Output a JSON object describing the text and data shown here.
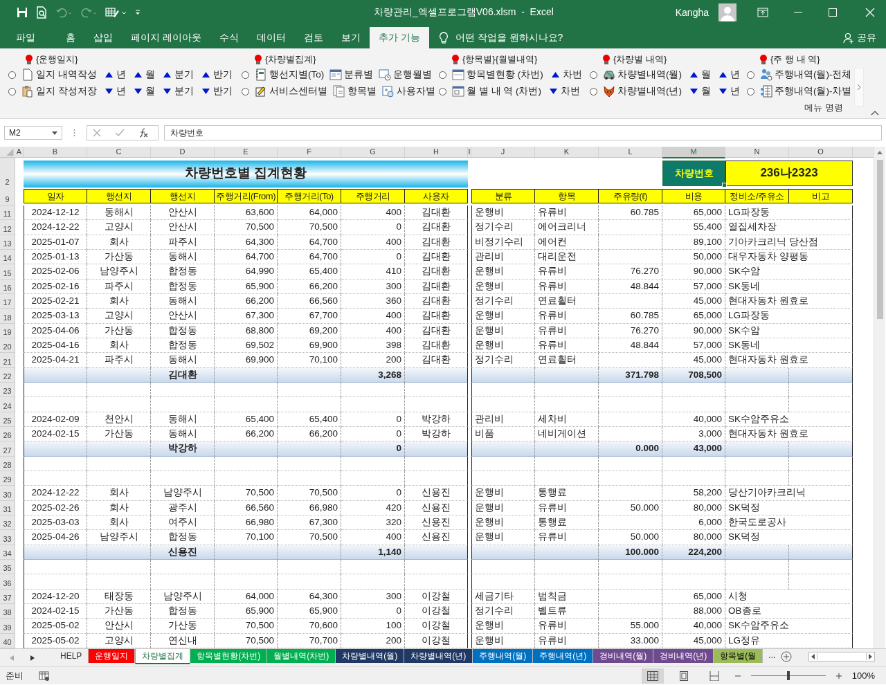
{
  "window": {
    "title": "차량관리_엑셀프로그램V06.xlsm  -  Excel",
    "user": "Kangha"
  },
  "ribbon_tabs": [
    {
      "label": "파일",
      "selected": false
    },
    {
      "label": "홈",
      "selected": false
    },
    {
      "label": "삽입",
      "selected": false
    },
    {
      "label": "페이지 레이아웃",
      "selected": false
    },
    {
      "label": "수식",
      "selected": false
    },
    {
      "label": "데이터",
      "selected": false
    },
    {
      "label": "검토",
      "selected": false
    },
    {
      "label": "보기",
      "selected": false
    },
    {
      "label": "추가 기능",
      "selected": true
    }
  ],
  "tell_me": "어떤 작업을 원하시나요?",
  "share": "공유",
  "ribbon": {
    "groups": [
      {
        "title": "{운행일지}",
        "lines": [
          [
            {
              "kind": "radio",
              "selected": false
            },
            {
              "kind": "command",
              "label": "일지 내역작성"
            },
            {
              "kind": "sort-up",
              "label": "년"
            },
            {
              "kind": "sort-up",
              "label": "월"
            },
            {
              "kind": "sort-up",
              "label": "분기"
            },
            {
              "kind": "sort-up",
              "label": "반기"
            }
          ],
          [
            {
              "kind": "radio",
              "selected": false
            },
            {
              "kind": "command",
              "label": "일지 작성저장"
            },
            {
              "kind": "sort-down",
              "label": "년"
            },
            {
              "kind": "sort-down",
              "label": "월"
            },
            {
              "kind": "sort-down",
              "label": "분기"
            },
            {
              "kind": "sort-down",
              "label": "반기"
            }
          ]
        ]
      },
      {
        "title": "{차량별집계}",
        "lines": [
          [
            {
              "kind": "radio",
              "selected": false
            },
            {
              "kind": "command",
              "label": "행선지별(To)"
            },
            {
              "kind": "command",
              "label": "분류별"
            },
            {
              "kind": "command",
              "label": "운행월별"
            }
          ],
          [
            {
              "kind": "radio",
              "selected": false
            },
            {
              "kind": "command",
              "label": "서비스센터별"
            },
            {
              "kind": "command",
              "label": "항목별"
            },
            {
              "kind": "command",
              "label": "사용자별"
            }
          ]
        ]
      },
      {
        "title": "{항목별}{월별내역}",
        "lines": [
          [
            {
              "kind": "radio",
              "selected": false
            },
            {
              "kind": "command",
              "label": "항목별현황 (차번)"
            },
            {
              "kind": "sort-up",
              "label": "차번"
            }
          ],
          [
            {
              "kind": "radio",
              "selected": false
            },
            {
              "kind": "command",
              "label": "월 별 내 역 (차번)"
            },
            {
              "kind": "sort-down",
              "label": "차번"
            }
          ]
        ]
      },
      {
        "title": "{차량별 내역}",
        "lines": [
          [
            {
              "kind": "radio",
              "selected": false
            },
            {
              "kind": "command",
              "label": "차량별내역(월)"
            },
            {
              "kind": "sort-up",
              "label": "월"
            },
            {
              "kind": "sort-up",
              "label": "년"
            }
          ],
          [
            {
              "kind": "radio",
              "selected": false
            },
            {
              "kind": "command",
              "label": "차량별내역(년)"
            },
            {
              "kind": "sort-down",
              "label": "월"
            },
            {
              "kind": "sort-down",
              "label": "년"
            }
          ]
        ]
      },
      {
        "title": "{주 행 내 역}",
        "lines": [
          [
            {
              "kind": "radio",
              "selected": false
            },
            {
              "kind": "command",
              "label": "주행내역(월)-전체"
            }
          ],
          [
            {
              "kind": "radio",
              "selected": false
            },
            {
              "kind": "command",
              "label": "주행내역(월)-차별"
            }
          ]
        ]
      }
    ],
    "group_label": "메뉴 명령"
  },
  "formula_bar": {
    "name_box": "M2",
    "content": "차량번호"
  },
  "sheet": {
    "columns": [
      {
        "label": "A",
        "selected": false
      },
      {
        "label": "B",
        "selected": false
      },
      {
        "label": "C",
        "selected": false
      },
      {
        "label": "D",
        "selected": false
      },
      {
        "label": "E",
        "selected": false
      },
      {
        "label": "F",
        "selected": false
      },
      {
        "label": "G",
        "selected": false
      },
      {
        "label": "H",
        "selected": false
      },
      {
        "label": "I",
        "selected": false
      },
      {
        "label": "J",
        "selected": false
      },
      {
        "label": "K",
        "selected": false
      },
      {
        "label": "L",
        "selected": false
      },
      {
        "label": "M",
        "selected": true
      },
      {
        "label": "N",
        "selected": false
      },
      {
        "label": "O",
        "selected": false
      }
    ],
    "title_row": "2",
    "banner": "차량번호별 집계현황",
    "key_label": "차량번호",
    "key_value": "236나2323",
    "header_row": "9",
    "headers_left": [
      "일자",
      "행선지",
      "행선지",
      "주행거리(From)",
      "주행거리(To)",
      "주행거리",
      "사용자"
    ],
    "headers_right": [
      "분류",
      "항목",
      "주유량(ℓ)",
      "비용",
      "정비소/주유소",
      "비고"
    ],
    "rows": [
      {
        "num": "11",
        "kind": "data",
        "date": "2024-12-12",
        "from": "동해시",
        "to": "안산시",
        "odo_from": "63,600",
        "odo_to": "64,000",
        "distance": "400",
        "user": "김대환",
        "category": "운행비",
        "item": "유류비",
        "fuel": "60.785",
        "cost": "65,000",
        "shop": "LG파장동"
      },
      {
        "num": "12",
        "kind": "data",
        "date": "2024-12-22",
        "from": "고양시",
        "to": "안산시",
        "odo_from": "70,500",
        "odo_to": "70,500",
        "distance": "0",
        "user": "김대환",
        "category": "정기수리",
        "item": "에어크리너",
        "cost": "55,400",
        "shop": "열집세차장"
      },
      {
        "num": "13",
        "kind": "data",
        "date": "2025-01-07",
        "from": "회사",
        "to": "파주시",
        "odo_from": "64,300",
        "odo_to": "64,700",
        "distance": "400",
        "user": "김대환",
        "category": "비정기수리",
        "item": "에어컨",
        "cost": "89,100",
        "shop": "기아카크리닉 당산점"
      },
      {
        "num": "14",
        "kind": "data",
        "date": "2025-01-13",
        "from": "가산동",
        "to": "동해시",
        "odo_from": "64,700",
        "odo_to": "64,700",
        "distance": "0",
        "user": "김대환",
        "category": "관리비",
        "item": "대리운전",
        "cost": "50,000",
        "shop": "대우자동차 양평동"
      },
      {
        "num": "15",
        "kind": "data",
        "date": "2025-02-06",
        "from": "남양주시",
        "to": "합정동",
        "odo_from": "64,990",
        "odo_to": "65,400",
        "distance": "410",
        "user": "김대환",
        "category": "운행비",
        "item": "유류비",
        "fuel": "76.270",
        "cost": "90,000",
        "shop": "SK수암"
      },
      {
        "num": "16",
        "kind": "data",
        "date": "2025-02-16",
        "from": "파주시",
        "to": "합정동",
        "odo_from": "65,900",
        "odo_to": "66,200",
        "distance": "300",
        "user": "김대환",
        "category": "운행비",
        "item": "유류비",
        "fuel": "48.844",
        "cost": "57,000",
        "shop": "SK동네"
      },
      {
        "num": "17",
        "kind": "data",
        "date": "2025-02-21",
        "from": "회사",
        "to": "동해시",
        "odo_from": "66,200",
        "odo_to": "66,560",
        "distance": "360",
        "user": "김대환",
        "category": "정기수리",
        "item": "연료휠터",
        "cost": "45,000",
        "shop": "현대자동차 원효로"
      },
      {
        "num": "18",
        "kind": "data",
        "date": "2025-03-13",
        "from": "고양시",
        "to": "안산시",
        "odo_from": "67,300",
        "odo_to": "67,700",
        "distance": "400",
        "user": "김대환",
        "category": "운행비",
        "item": "유류비",
        "fuel": "60.785",
        "cost": "65,000",
        "shop": "LG파장동"
      },
      {
        "num": "19",
        "kind": "data",
        "date": "2025-04-06",
        "from": "가산동",
        "to": "합정동",
        "odo_from": "68,800",
        "odo_to": "69,200",
        "distance": "400",
        "user": "김대환",
        "category": "운행비",
        "item": "유류비",
        "fuel": "76.270",
        "cost": "90,000",
        "shop": "SK수암"
      },
      {
        "num": "20",
        "kind": "data",
        "date": "2025-04-16",
        "from": "회사",
        "to": "합정동",
        "odo_from": "69,502",
        "odo_to": "69,900",
        "distance": "398",
        "user": "김대환",
        "category": "운행비",
        "item": "유류비",
        "fuel": "48.844",
        "cost": "57,000",
        "shop": "SK동네"
      },
      {
        "num": "21",
        "kind": "data",
        "date": "2025-04-21",
        "from": "파주시",
        "to": "동해시",
        "odo_from": "69,900",
        "odo_to": "70,100",
        "distance": "200",
        "user": "김대환",
        "category": "정기수리",
        "item": "연료휠터",
        "cost": "45,000",
        "shop": "현대자동차 원효로"
      },
      {
        "num": "22",
        "kind": "subtotal",
        "user": "김대환",
        "distance": "3,268",
        "fuel": "371.798",
        "cost": "708,500"
      },
      {
        "num": "23",
        "kind": "blank"
      },
      {
        "num": "24",
        "kind": "blank"
      },
      {
        "num": "25",
        "kind": "data",
        "date": "2024-02-09",
        "from": "천안시",
        "to": "동해시",
        "odo_from": "65,400",
        "odo_to": "65,400",
        "distance": "0",
        "user": "박강하",
        "category": "관리비",
        "item": "세차비",
        "cost": "40,000",
        "shop": "SK수암주유소"
      },
      {
        "num": "26",
        "kind": "data",
        "date": "2024-02-15",
        "from": "가산동",
        "to": "동해시",
        "odo_from": "66,200",
        "odo_to": "66,200",
        "distance": "0",
        "user": "박강하",
        "category": "비품",
        "item": "네비게이션",
        "cost": "3,000",
        "shop": "현대자동차 원효로"
      },
      {
        "num": "27",
        "kind": "subtotal",
        "user": "박강하",
        "distance": "0",
        "fuel": "0.000",
        "cost": "43,000"
      },
      {
        "num": "28",
        "kind": "blank"
      },
      {
        "num": "29",
        "kind": "blank"
      },
      {
        "num": "30",
        "kind": "data",
        "date": "2024-12-22",
        "from": "회사",
        "to": "남양주시",
        "odo_from": "70,500",
        "odo_to": "70,500",
        "distance": "0",
        "user": "신용진",
        "category": "운행비",
        "item": "통행료",
        "cost": "58,200",
        "shop": "당산기아카크리닉"
      },
      {
        "num": "31",
        "kind": "data",
        "date": "2025-02-26",
        "from": "회사",
        "to": "광주시",
        "odo_from": "66,560",
        "odo_to": "66,980",
        "distance": "420",
        "user": "신용진",
        "category": "운행비",
        "item": "유류비",
        "fuel": "50.000",
        "cost": "80,000",
        "shop": "SK덕정"
      },
      {
        "num": "32",
        "kind": "data",
        "date": "2025-03-03",
        "from": "회사",
        "to": "여주시",
        "odo_from": "66,980",
        "odo_to": "67,300",
        "distance": "320",
        "user": "신용진",
        "category": "운행비",
        "item": "통행료",
        "cost": "6,000",
        "shop": "한국도로공사"
      },
      {
        "num": "33",
        "kind": "data",
        "date": "2025-04-26",
        "from": "남양주시",
        "to": "합정동",
        "odo_from": "70,100",
        "odo_to": "70,500",
        "distance": "400",
        "user": "신용진",
        "category": "운행비",
        "item": "유류비",
        "fuel": "50.000",
        "cost": "80,000",
        "shop": "SK덕정"
      },
      {
        "num": "34",
        "kind": "subtotal",
        "user": "신용진",
        "distance": "1,140",
        "fuel": "100.000",
        "cost": "224,200"
      },
      {
        "num": "35",
        "kind": "blank"
      },
      {
        "num": "36",
        "kind": "blank"
      },
      {
        "num": "37",
        "kind": "data",
        "date": "2024-12-20",
        "from": "태장동",
        "to": "남양주시",
        "odo_from": "64,000",
        "odo_to": "64,300",
        "distance": "300",
        "user": "이강철",
        "category": "세금기타",
        "item": "범칙금",
        "cost": "65,000",
        "shop": "시청"
      },
      {
        "num": "38",
        "kind": "data",
        "date": "2024-02-15",
        "from": "가산동",
        "to": "합정동",
        "odo_from": "65,900",
        "odo_to": "65,900",
        "distance": "0",
        "user": "이강철",
        "category": "정기수리",
        "item": "벨트류",
        "cost": "88,000",
        "shop": "OB종로"
      },
      {
        "num": "39",
        "kind": "data",
        "date": "2025-05-02",
        "from": "안산시",
        "to": "가산동",
        "odo_from": "70,500",
        "odo_to": "70,600",
        "distance": "100",
        "user": "이강철",
        "category": "운행비",
        "item": "유류비",
        "fuel": "55.000",
        "cost": "40,000",
        "shop": "SK수암주유소"
      },
      {
        "num": "40",
        "kind": "data",
        "date": "2025-05-02",
        "from": "고양시",
        "to": "연신내",
        "odo_from": "70,500",
        "odo_to": "70,700",
        "distance": "200",
        "user": "이강철",
        "category": "운행비",
        "item": "유류비",
        "fuel": "33.000",
        "cost": "45,000",
        "shop": "LG정유"
      }
    ]
  },
  "sheet_tabs": [
    {
      "label": "HELP",
      "selected": false
    },
    {
      "label": "운행일지",
      "selected": false,
      "color": "#ff0000"
    },
    {
      "label": "차량별집계",
      "selected": true
    },
    {
      "label": "항목별현황(차번)",
      "selected": false,
      "color": "#00b050"
    },
    {
      "label": "월별내역(차번)",
      "selected": false,
      "color": "#00b050"
    },
    {
      "label": "차량별내역(월)",
      "selected": false,
      "color": "#1f3864"
    },
    {
      "label": "차량별내역(년)",
      "selected": false,
      "color": "#1f3864"
    },
    {
      "label": "주행내역(월)",
      "selected": false,
      "color": "#0070c0"
    },
    {
      "label": "주행내역(년)",
      "selected": false,
      "color": "#0070c0"
    },
    {
      "label": "경비내역(월)",
      "selected": false,
      "color": "#6f4a8e"
    },
    {
      "label": "경비내역(년)",
      "selected": false,
      "color": "#6f4a8e"
    },
    {
      "label": "항목별(월",
      "selected": false,
      "color": "#9bbb59"
    }
  ],
  "more_tabs": "...",
  "status_bar": {
    "status": "준비",
    "zoom": {
      "level": 0.5,
      "reading": "100%"
    }
  }
}
